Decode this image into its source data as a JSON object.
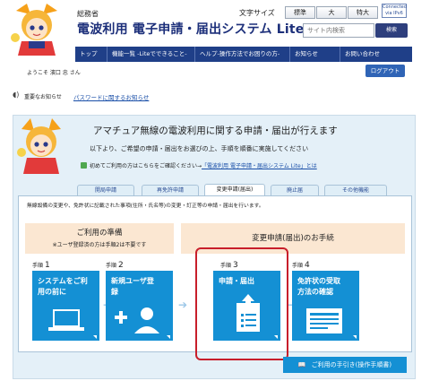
{
  "header": {
    "ministry": "総務省",
    "system_title": "電波利用 電子申請・届出システム Lite",
    "font_size_label": "文字サイズ",
    "font_sizes": [
      "標準",
      "大",
      "特大"
    ],
    "ipv6_badge": "Connected via IPv6",
    "search_placeholder": "サイト内検索",
    "search_button": "検索"
  },
  "nav": {
    "items": [
      "トップ",
      "機能一覧 -Liteでできること-",
      "ヘルプ-操作方法でお困りの方-",
      "お知らせ",
      "お問い合わせ"
    ]
  },
  "user": {
    "welcome": "ようこそ 濱口 忠 さん",
    "logout": "ログアウト"
  },
  "notice": {
    "label": "重要なお知らせ",
    "link": "パスワードに関するお知らせ"
  },
  "intro": {
    "line1": "アマチュア無線の電波利用に関する申請・届出が行えます",
    "line2": "以下より、ご希望の申請・届出をお選びの上、手順を順番に実施してください",
    "first_time_prefix": "初めてご利用の方はこちらをご確認ください→",
    "first_time_link": "「電波利用 電子申請・届出システム Lite」とは"
  },
  "tabs": [
    {
      "label": "開局申請",
      "active": false
    },
    {
      "label": "再免許申請",
      "active": false
    },
    {
      "label": "変更申請(届出)",
      "active": true
    },
    {
      "label": "廃止届",
      "active": false
    },
    {
      "label": "その他機能",
      "active": false
    }
  ],
  "content": {
    "description": "無線設備の変更や、免許状に記載された事項(住所・氏名等)の変更・訂正等の申請・届出を行います。",
    "prep_title": "ご利用の準備",
    "prep_note": "※ユーザ登録済の方は手順2は不要です",
    "proc_title": "変更申請(届出)のお手続",
    "step_prefix": "手順",
    "steps": [
      {
        "num": "1",
        "text1": "システムをご利",
        "text2": "用の前に"
      },
      {
        "num": "2",
        "text1": "新規ユーザ登",
        "text2": "録"
      },
      {
        "num": "3",
        "text1": "申請・届出",
        "text2": ""
      },
      {
        "num": "4",
        "text1": "免許状の受取",
        "text2": "方法の確認"
      }
    ],
    "guide_button": "ご利用の手引き(操作手順書)"
  },
  "colors": {
    "nav": "#1f3f88",
    "card": "#1490d4",
    "highlight": "#c81e2b",
    "panel": "#e4f0f8",
    "peach": "#fbe7d2"
  }
}
